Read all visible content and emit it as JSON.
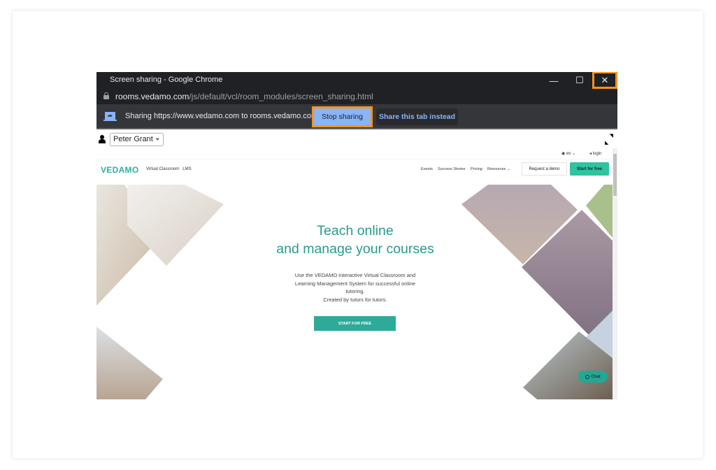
{
  "window": {
    "title": "Screen sharing - Google Chrome",
    "controls": {
      "minimize": "—",
      "maximize": "☐",
      "close": "✕"
    }
  },
  "address_bar": {
    "host": "rooms.vedamo.com",
    "path": "/js/default/vcl/room_modules/screen_sharing.html"
  },
  "share_bar": {
    "message": "Sharing https://www.vedamo.com to rooms.vedamo.com",
    "stop_label": "Stop sharing",
    "share_tab_label": "Share this tab instead"
  },
  "viewer": {
    "selected_user": "Peter Grant"
  },
  "shared_page": {
    "lang": "en",
    "login": "login",
    "logo": "VEDAMO",
    "logo_links": [
      "Virtual Classroom",
      "LMS"
    ],
    "nav": [
      "Events",
      "Success Stories",
      "Pricing",
      "Resources"
    ],
    "request_demo": "Request a demo",
    "start_free": "Start for free",
    "hero_title_line1": "Teach online",
    "hero_title_line2": "and manage your courses",
    "hero_text_line1": "Use the VEDAMO interactive Virtual Classroom and",
    "hero_text_line2": "Learning Management System for successful online",
    "hero_text_line3": "tutoring.",
    "hero_text_line4": "Created by tutors for tutors.",
    "hero_button": "START FOR FREE",
    "chat": "Chat"
  },
  "colors": {
    "highlight": "#f7931e",
    "chrome_dark": "#202124",
    "accent_blue": "#8ab4f8",
    "vedamo_teal": "#2ab3a0"
  }
}
